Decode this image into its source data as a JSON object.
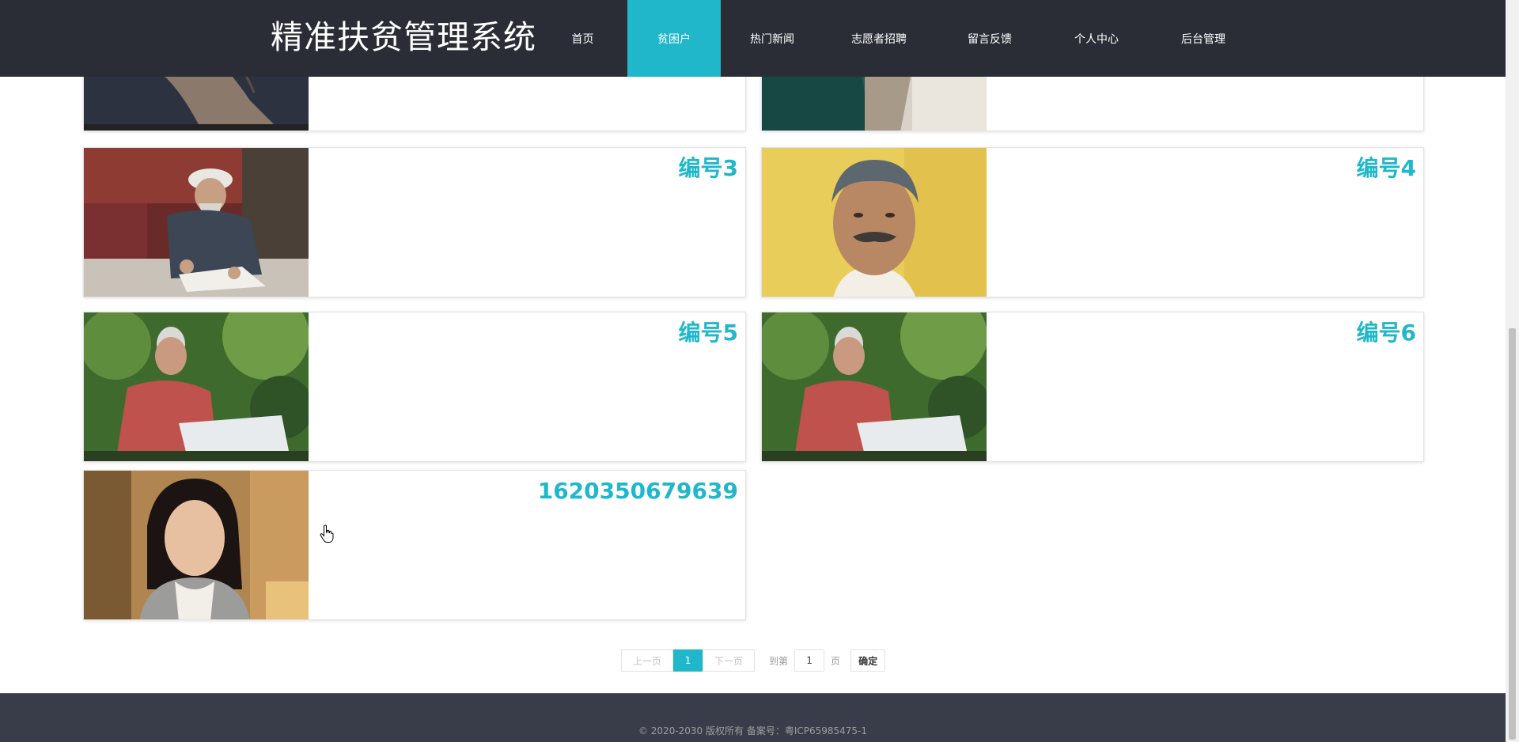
{
  "header": {
    "site_title": "精准扶贫管理系统",
    "nav": [
      {
        "label": "首页",
        "active": false
      },
      {
        "label": "贫困户",
        "active": true
      },
      {
        "label": "热门新闻",
        "active": false
      },
      {
        "label": "志愿者招聘",
        "active": false
      },
      {
        "label": "留言反馈",
        "active": false
      },
      {
        "label": "个人中心",
        "active": false
      },
      {
        "label": "后台管理",
        "active": false
      }
    ]
  },
  "cards": [
    {
      "title": ""
    },
    {
      "title": ""
    },
    {
      "title": "编号3"
    },
    {
      "title": "编号4"
    },
    {
      "title": "编号5"
    },
    {
      "title": "编号6"
    },
    {
      "title": "1620350679639"
    }
  ],
  "pagination": {
    "prev_label": "上一页",
    "current_page": "1",
    "next_label": "下一页",
    "goto_prefix": "到第",
    "goto_value": "1",
    "goto_suffix": "页",
    "confirm_label": "确定"
  },
  "footer": {
    "copyright": "© 2020-2030 版权所有 备案号：粤ICP65985475-1"
  },
  "colors": {
    "accent": "#1fb7c9",
    "header_bg": "#2a2d35",
    "footer_bg": "#393d49"
  }
}
